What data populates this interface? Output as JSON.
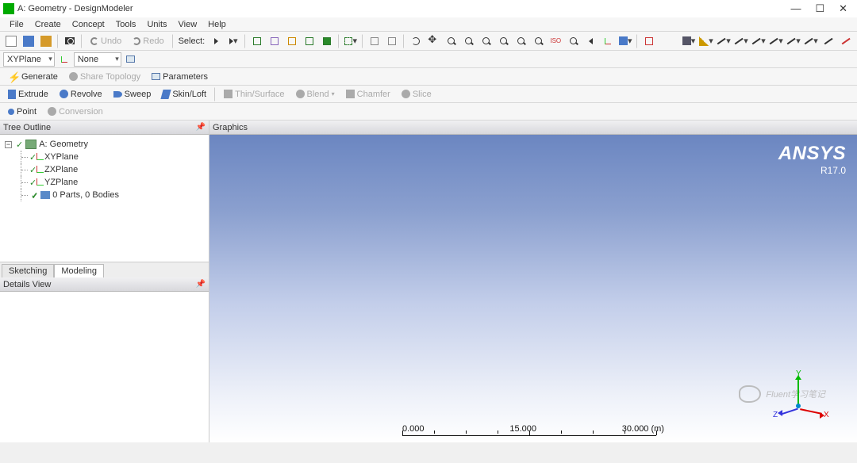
{
  "window": {
    "title": "A: Geometry - DesignModeler"
  },
  "wincontrols": {
    "min": "—",
    "max": "☐",
    "close": "✕"
  },
  "menu": {
    "file": "File",
    "create": "Create",
    "concept": "Concept",
    "tools": "Tools",
    "units": "Units",
    "view": "View",
    "help": "Help"
  },
  "tb1": {
    "undo": "Undo",
    "redo": "Redo",
    "select": "Select:"
  },
  "tb2": {
    "plane_sel": "XYPlane",
    "sketch_sel": "None"
  },
  "tb3": {
    "generate": "Generate",
    "share": "Share Topology",
    "params": "Parameters"
  },
  "tb4": {
    "extrude": "Extrude",
    "revolve": "Revolve",
    "sweep": "Sweep",
    "skin": "Skin/Loft",
    "thin": "Thin/Surface",
    "blend": "Blend",
    "chamfer": "Chamfer",
    "slice": "Slice"
  },
  "tb5": {
    "point": "Point",
    "conversion": "Conversion"
  },
  "panels": {
    "tree": "Tree Outline",
    "details": "Details View",
    "graphics": "Graphics"
  },
  "tree": {
    "root": "A: Geometry",
    "items": [
      "XYPlane",
      "ZXPlane",
      "YZPlane",
      "0 Parts, 0 Bodies"
    ]
  },
  "tabs": {
    "sketching": "Sketching",
    "modeling": "Modeling"
  },
  "brand": {
    "name": "ANSYS",
    "ver": "R17.0"
  },
  "ruler": {
    "t0": "0.000",
    "t1": "15.000",
    "t2": "30.000 (m)"
  },
  "triad": {
    "x": "X",
    "y": "Y",
    "z": "Z"
  },
  "watermark": "Fluent学习笔记"
}
